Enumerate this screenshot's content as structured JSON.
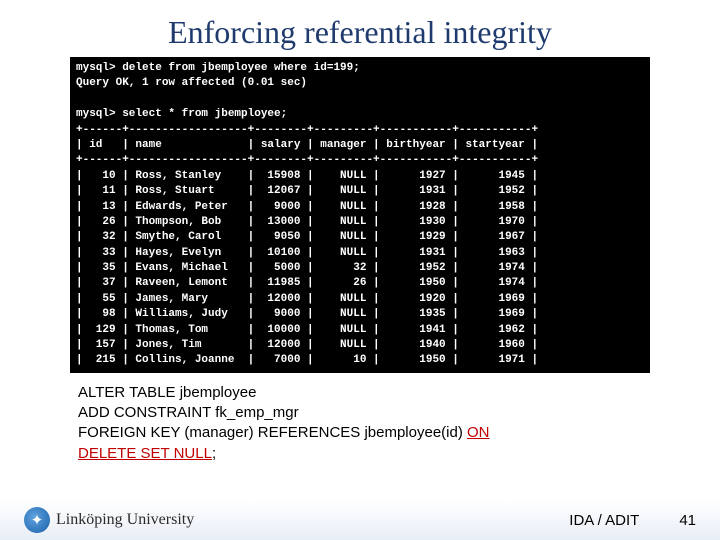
{
  "title": "Enforcing referential integrity",
  "terminal": {
    "prompt": "mysql>",
    "command1": "delete from jbemployee where id=199;",
    "result1": "Query OK, 1 row affected (0.01 sec)",
    "command2": "select * from jbemployee;",
    "columns": [
      "id",
      "name",
      "salary",
      "manager",
      "birthyear",
      "startyear"
    ],
    "rows": [
      {
        "id": 10,
        "name": "Ross, Stanley",
        "salary": 15908,
        "manager": "NULL",
        "birthyear": 1927,
        "startyear": 1945
      },
      {
        "id": 11,
        "name": "Ross, Stuart",
        "salary": 12067,
        "manager": "NULL",
        "birthyear": 1931,
        "startyear": 1952
      },
      {
        "id": 13,
        "name": "Edwards, Peter",
        "salary": 9000,
        "manager": "NULL",
        "birthyear": 1928,
        "startyear": 1958
      },
      {
        "id": 26,
        "name": "Thompson, Bob",
        "salary": 13000,
        "manager": "NULL",
        "birthyear": 1930,
        "startyear": 1970
      },
      {
        "id": 32,
        "name": "Smythe, Carol",
        "salary": 9050,
        "manager": "NULL",
        "birthyear": 1929,
        "startyear": 1967
      },
      {
        "id": 33,
        "name": "Hayes, Evelyn",
        "salary": 10100,
        "manager": "NULL",
        "birthyear": 1931,
        "startyear": 1963
      },
      {
        "id": 35,
        "name": "Evans, Michael",
        "salary": 5000,
        "manager": "32",
        "birthyear": 1952,
        "startyear": 1974
      },
      {
        "id": 37,
        "name": "Raveen, Lemont",
        "salary": 11985,
        "manager": "26",
        "birthyear": 1950,
        "startyear": 1974
      },
      {
        "id": 55,
        "name": "James, Mary",
        "salary": 12000,
        "manager": "NULL",
        "birthyear": 1920,
        "startyear": 1969
      },
      {
        "id": 98,
        "name": "Williams, Judy",
        "salary": 9000,
        "manager": "NULL",
        "birthyear": 1935,
        "startyear": 1969
      },
      {
        "id": 129,
        "name": "Thomas, Tom",
        "salary": 10000,
        "manager": "NULL",
        "birthyear": 1941,
        "startyear": 1962
      },
      {
        "id": 157,
        "name": "Jones, Tim",
        "salary": 12000,
        "manager": "NULL",
        "birthyear": 1940,
        "startyear": 1960
      },
      {
        "id": 215,
        "name": "Collins, Joanne",
        "salary": 7000,
        "manager": "10",
        "birthyear": 1950,
        "startyear": 1971
      }
    ]
  },
  "sql": {
    "l1": "ALTER TABLE jbemployee",
    "l2": "ADD CONSTRAINT fk_emp_mgr",
    "l3_a": "FOREIGN KEY (manager) REFERENCES jbemployee(id) ",
    "l3_h": "ON",
    "l4_h": "DELETE SET NULL",
    "l4_b": ";"
  },
  "footer": {
    "logo": "Linköping University",
    "source": "IDA / ADIT",
    "page": "41"
  }
}
